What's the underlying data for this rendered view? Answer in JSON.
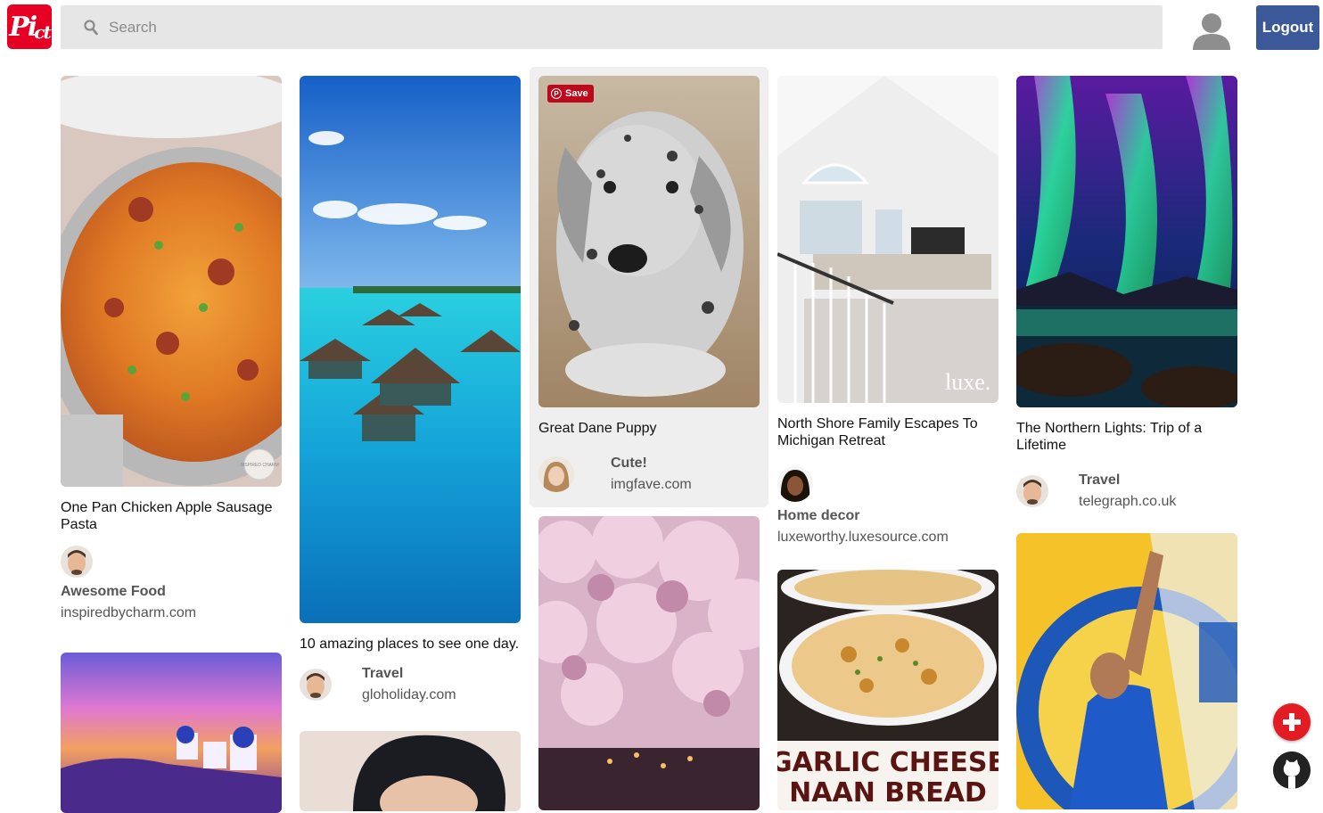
{
  "header": {
    "logo_text": "Pi",
    "logo_sub": "ct",
    "search_placeholder": "Search",
    "logout_label": "Logout"
  },
  "pins": [
    {
      "title": "One Pan Chicken Apple Sausage Pasta",
      "board": "Awesome Food",
      "source": "inspiredbycharm.com",
      "badge": "INSPIRED CHARM"
    },
    {
      "title": "10 amazing places to see one day.",
      "board": "Travel",
      "source": "gloholiday.com"
    },
    {
      "title": "Great Dane Puppy",
      "board": "Cute!",
      "source": "imgfave.com",
      "save_label": "Save"
    },
    {
      "title": "North Shore Family Escapes To Michigan Retreat",
      "board": "Home decor",
      "source": "luxeworthy.luxesource.com",
      "watermark": "luxe."
    },
    {
      "title": "The Northern Lights: Trip of a Lifetime",
      "board": "Travel",
      "source": "telegraph.co.uk"
    },
    {
      "overlay_text_1": "GARLIC CHEESE",
      "overlay_text_2": "NAAN BREAD"
    }
  ],
  "colors": {
    "brand": "#e60023",
    "logout": "#3b5998",
    "save": "#bd081c",
    "fab_add": "#e31b23"
  },
  "icons": {
    "search": "search-icon",
    "profile": "user-icon",
    "add": "plus-icon",
    "github": "github-icon"
  }
}
